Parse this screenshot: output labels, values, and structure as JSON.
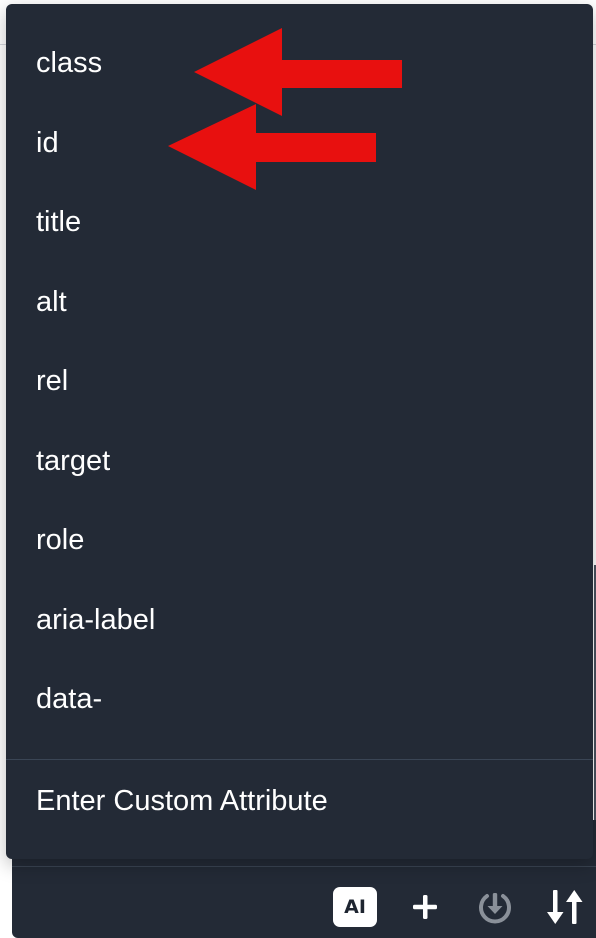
{
  "menu": {
    "items": [
      {
        "label": "class"
      },
      {
        "label": "id"
      },
      {
        "label": "title"
      },
      {
        "label": "alt"
      },
      {
        "label": "rel"
      },
      {
        "label": "target"
      },
      {
        "label": "role"
      },
      {
        "label": "aria-label"
      },
      {
        "label": "data-"
      }
    ],
    "custom_label": "Enter Custom Attribute"
  },
  "toolbar": {
    "ai_label": "AI",
    "icons": [
      "ai-icon",
      "plus-icon",
      "power-download-icon",
      "sort-arrows-icon"
    ]
  },
  "annotations": {
    "arrow_color": "#e8100f",
    "arrows": [
      "arrow-pointing-at-class",
      "arrow-pointing-at-id"
    ]
  },
  "colors": {
    "menu_bg": "#232a36",
    "text": "#ffffff",
    "divider": "#3a4555"
  }
}
